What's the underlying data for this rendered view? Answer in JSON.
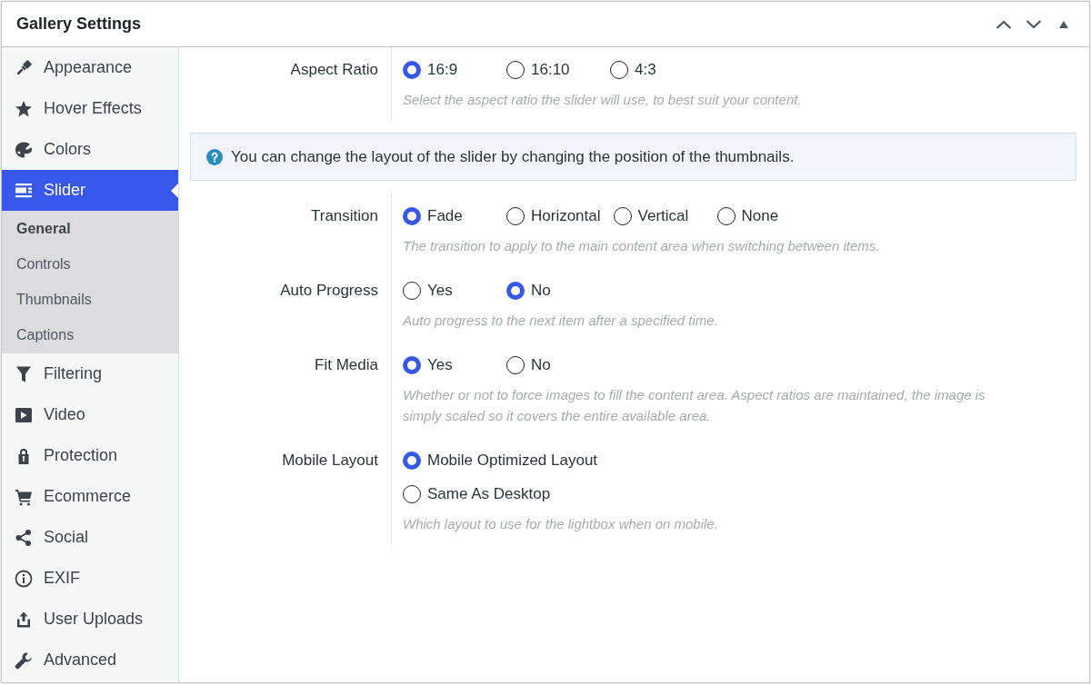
{
  "panel": {
    "title": "Gallery Settings"
  },
  "sidebar": {
    "items": [
      {
        "label": "Appearance",
        "selected": false
      },
      {
        "label": "Hover Effects",
        "selected": false
      },
      {
        "label": "Colors",
        "selected": false
      },
      {
        "label": "Slider",
        "selected": true,
        "children": [
          {
            "label": "General",
            "selected": true
          },
          {
            "label": "Controls",
            "selected": false
          },
          {
            "label": "Thumbnails",
            "selected": false
          },
          {
            "label": "Captions",
            "selected": false
          }
        ]
      },
      {
        "label": "Filtering",
        "selected": false
      },
      {
        "label": "Video",
        "selected": false
      },
      {
        "label": "Protection",
        "selected": false
      },
      {
        "label": "Ecommerce",
        "selected": false
      },
      {
        "label": "Social",
        "selected": false
      },
      {
        "label": "EXIF",
        "selected": false
      },
      {
        "label": "User Uploads",
        "selected": false
      },
      {
        "label": "Advanced",
        "selected": false
      }
    ]
  },
  "content": [
    {
      "kind": "group",
      "fields": [
        {
          "label": "Aspect Ratio",
          "kind": "inline",
          "options": [
            {
              "label": "16:9",
              "selected": true
            },
            {
              "label": "16:10",
              "selected": false
            },
            {
              "label": "4:3",
              "selected": false
            }
          ],
          "description": "Select the aspect ratio the slider will use, to best suit your content."
        }
      ]
    },
    {
      "kind": "notice",
      "text": "You can change the layout of the slider by changing the position of the thumbnails."
    },
    {
      "kind": "group",
      "fields": [
        {
          "label": "Transition",
          "kind": "inline",
          "options": [
            {
              "label": "Fade",
              "selected": true
            },
            {
              "label": "Horizontal",
              "selected": false
            },
            {
              "label": "Vertical",
              "selected": false
            },
            {
              "label": "None",
              "selected": false
            }
          ],
          "description": "The transition to apply to the main content area when switching between items."
        },
        {
          "label": "Auto Progress",
          "kind": "inline",
          "options": [
            {
              "label": "Yes",
              "selected": false
            },
            {
              "label": "No",
              "selected": true
            }
          ],
          "description": "Auto progress to the next item after a specified time."
        },
        {
          "label": "Fit Media",
          "kind": "inline",
          "options": [
            {
              "label": "Yes",
              "selected": true
            },
            {
              "label": "No",
              "selected": false
            }
          ],
          "description": "Whether or not to force images to fill the content area. Aspect ratios are maintained, the image is simply scaled so it covers the entire available area."
        },
        {
          "label": "Mobile Layout",
          "kind": "stacked",
          "options": [
            {
              "label": "Mobile Optimized Layout",
              "selected": true
            },
            {
              "label": "Same As Desktop",
              "selected": false
            }
          ],
          "description": "Which layout to use for the lightbox when on mobile."
        }
      ]
    }
  ]
}
